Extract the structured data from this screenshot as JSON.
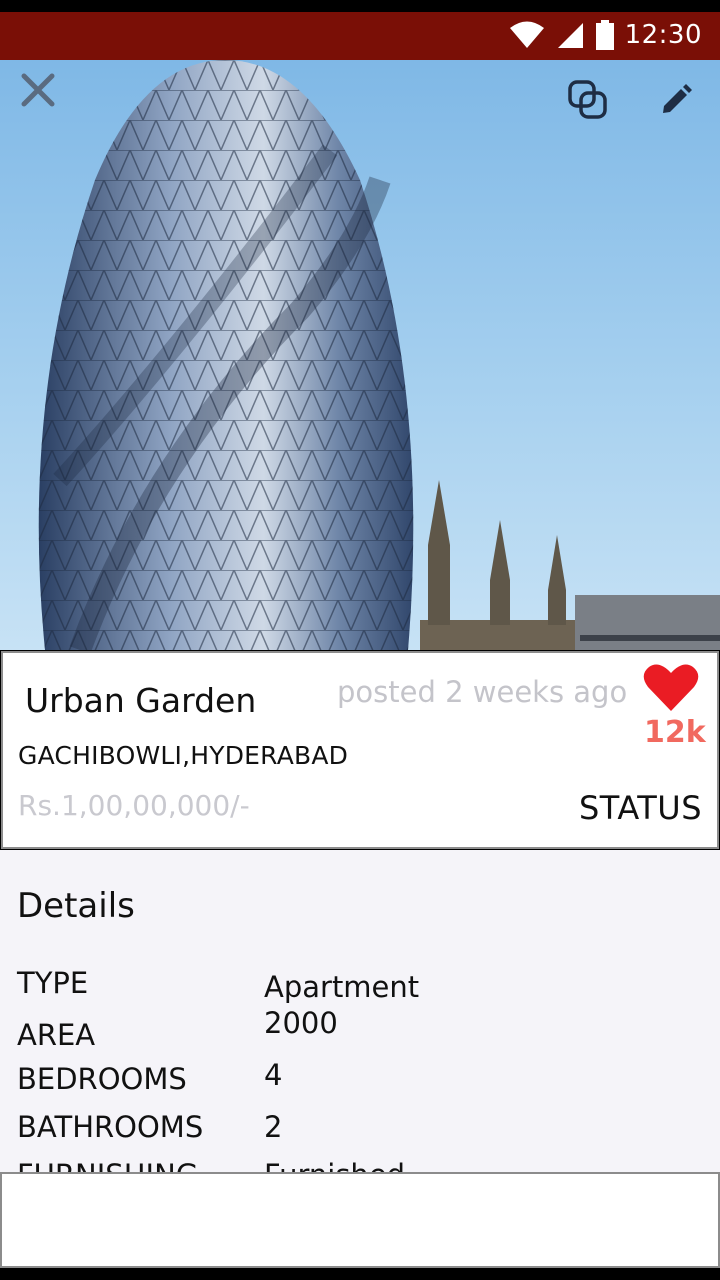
{
  "status_bar": {
    "time": "12:30",
    "icons": [
      "wifi-icon",
      "signal-icon",
      "battery-icon"
    ]
  },
  "toolbar": {
    "close_icon": "close-icon",
    "copy_icon": "copy-icon",
    "edit_icon": "edit-icon"
  },
  "listing": {
    "title": "Urban Garden",
    "posted": "posted 2 weeks ago",
    "likes": "12k",
    "location": "GACHIBOWLI,HYDERABAD",
    "price": "Rs.1,00,00,000/-",
    "status": "STATUS"
  },
  "details": {
    "heading": "Details",
    "rows": [
      {
        "label": "TYPE",
        "value": "Apartment"
      },
      {
        "label": "AREA",
        "value": "2000"
      },
      {
        "label": "BEDROOMS",
        "value": "4"
      },
      {
        "label": "BATHROOMS",
        "value": "2"
      },
      {
        "label": "FURNISHING",
        "value": "Furnished"
      }
    ]
  },
  "colors": {
    "status_bar": "#7a0f06",
    "heart": "#ea1c24",
    "likes": "#f1695f"
  }
}
